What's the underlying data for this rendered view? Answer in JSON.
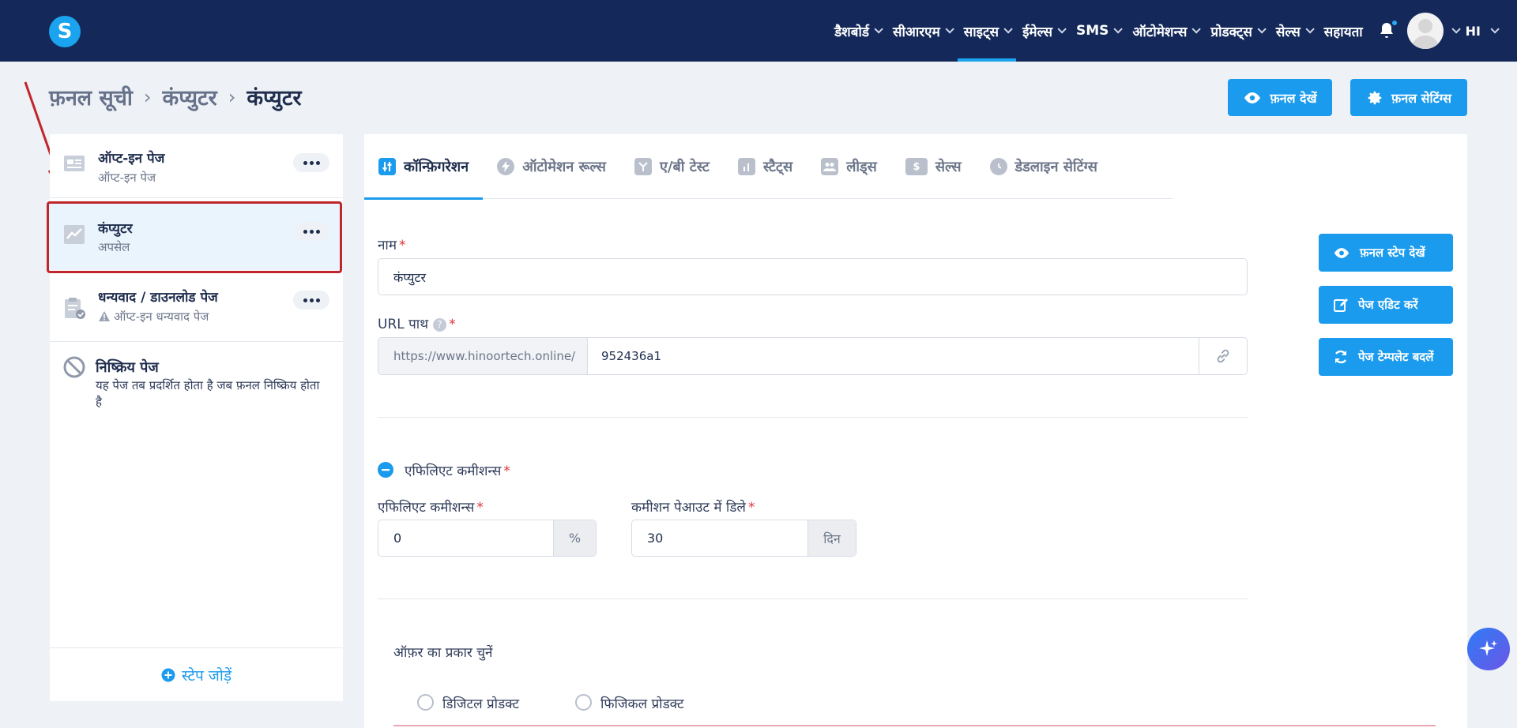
{
  "nav": {
    "logo_letter": "S",
    "items": [
      {
        "label": "डैशबोर्ड",
        "active": false
      },
      {
        "label": "सीआरएम",
        "active": false
      },
      {
        "label": "साइट्स",
        "active": true
      },
      {
        "label": "ईमेल्स",
        "active": false
      },
      {
        "label": "SMS",
        "active": false
      },
      {
        "label": "ऑटोमेशन्स",
        "active": false
      },
      {
        "label": "प्रोडक्ट्स",
        "active": false
      },
      {
        "label": "सेल्स",
        "active": false
      }
    ],
    "help_label": "सहायता",
    "user_initials": "HI"
  },
  "breadcrumb": {
    "items": [
      "फ़नल सूची",
      "कंप्युटर",
      "कंप्युटर"
    ]
  },
  "header_buttons": {
    "view_funnel": "फ़नल देखें",
    "funnel_settings": "फ़नल सेटिंग्स"
  },
  "steps": [
    {
      "title": "ऑप्ट-इन पेज",
      "subtitle": "ऑप्ट-इन पेज"
    },
    {
      "title": "कंप्युटर",
      "subtitle": "अपसेल"
    },
    {
      "title": "धन्यवाद / डाउनलोड पेज",
      "subtitle": "ऑप्ट-इन धन्यवाद पेज"
    }
  ],
  "inactive_page": {
    "title": "निष्क्रिय पेज",
    "description": "यह पेज तब प्रदर्शित होता है जब फ़नल निष्क्रिय होता है"
  },
  "add_step_label": "स्टेप जोड़ें",
  "tabs": [
    {
      "label": "कॉन्फ़िगरेशन",
      "icon": "sliders-icon",
      "active": true
    },
    {
      "label": "ऑटोमेशन रूल्स",
      "icon": "bolt-icon",
      "active": false
    },
    {
      "label": "ए/बी टेस्ट",
      "icon": "split-icon",
      "active": false
    },
    {
      "label": "स्टैट्स",
      "icon": "bar-chart-icon",
      "active": false
    },
    {
      "label": "लीड्स",
      "icon": "users-icon",
      "active": false
    },
    {
      "label": "सेल्स",
      "icon": "dollar-icon",
      "active": false
    },
    {
      "label": "डेडलाइन सेटिंग्स",
      "icon": "clock-icon",
      "active": false
    }
  ],
  "form": {
    "name_label": "नाम",
    "name_value": "कंप्युटर",
    "url_label": "URL पाथ",
    "url_prefix": "https://www.hinoortech.online/",
    "url_value": "952436a1",
    "affiliate_toggle_label": "एफिलिएट कमीशन्स",
    "affiliate_label": "एफिलिएट कमीशन्स",
    "affiliate_value": "0",
    "affiliate_suffix": "%",
    "payout_label": "कमीशन पेआउट में डिले",
    "payout_value": "30",
    "payout_suffix": "दिन",
    "offer_type_label": "ऑफ़र का प्रकार चुनें",
    "offer_options": [
      "डिजिटल प्रोडक्ट",
      "फिजिकल प्रोडक्ट"
    ]
  },
  "side_buttons": {
    "view_step": "फ़नल स्टेप देखें",
    "edit_page": "पेज एडिट करें",
    "change_template": "पेज टेम्पलेट बदलें"
  },
  "colors": {
    "nav_bg": "#14295a",
    "primary": "#1b9bed",
    "highlight_border": "#c0262c"
  }
}
